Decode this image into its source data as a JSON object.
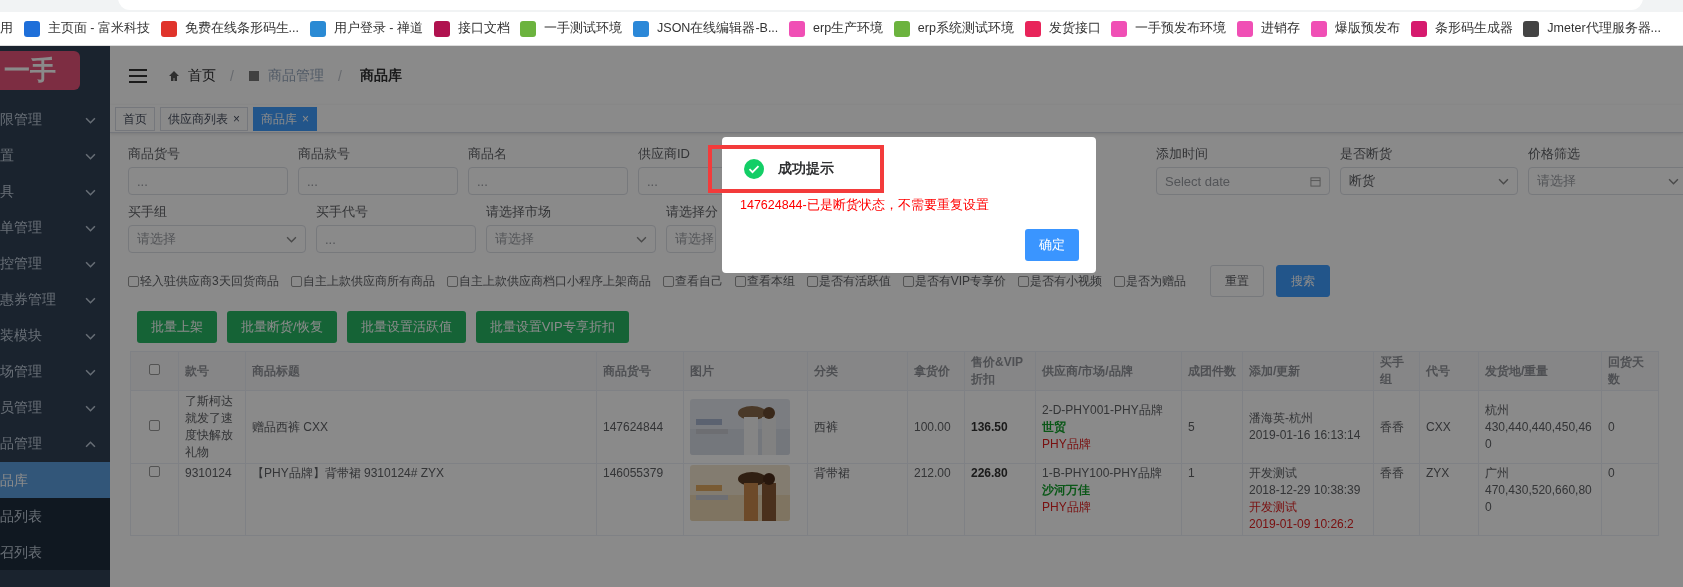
{
  "browser": {
    "bookmarks": [
      {
        "label": "用"
      },
      {
        "label": "主页面 - 富米科技",
        "color": "#1e6fd9"
      },
      {
        "label": "免费在线条形码生...",
        "color": "#e0342b"
      },
      {
        "label": "用户登录 - 禅道",
        "color": "#2a8ad4"
      },
      {
        "label": "接口文档",
        "color": "#b0124f"
      },
      {
        "label": "一手测试环境",
        "color": "#6cb33e"
      },
      {
        "label": "JSON在线编辑器-B...",
        "color": "#2b88d8"
      },
      {
        "label": "erp生产环境",
        "color": "#f04fb5"
      },
      {
        "label": "erp系统测试环境",
        "color": "#6cb33e"
      },
      {
        "label": "发货接口",
        "color": "#e8245a"
      },
      {
        "label": "一手预发布环境",
        "color": "#f04fb5"
      },
      {
        "label": "进销存",
        "color": "#f04fb5"
      },
      {
        "label": "爆版预发布",
        "color": "#f04fb5"
      },
      {
        "label": "条形码生成器",
        "color": "#d61a6e"
      },
      {
        "label": "Jmeter代理服务器...",
        "color": "#444444"
      }
    ]
  },
  "logo": "一手",
  "sidebar": [
    {
      "label": "限管理",
      "expanded": false
    },
    {
      "label": "置",
      "expanded": false
    },
    {
      "label": "具",
      "expanded": false
    },
    {
      "label": "单管理",
      "expanded": false
    },
    {
      "label": "控管理",
      "expanded": false
    },
    {
      "label": "惠券管理",
      "expanded": false
    },
    {
      "label": "装模块",
      "expanded": false
    },
    {
      "label": "场管理",
      "expanded": false
    },
    {
      "label": "员管理",
      "expanded": false
    },
    {
      "label": "品管理",
      "expanded": true,
      "children": [
        {
          "label": "品库",
          "selected": true
        },
        {
          "label": "品列表",
          "selected": false
        },
        {
          "label": "召列表",
          "selected": false
        }
      ]
    }
  ],
  "breadcrumb": [
    "首页",
    "商品管理",
    "商品库"
  ],
  "breadcrumb_separator": "/",
  "tabs": [
    {
      "label": "首页",
      "selected": false
    },
    {
      "label": "供应商列表",
      "close": "×",
      "selected": false
    },
    {
      "label": "商品库",
      "close": "×",
      "selected": true
    }
  ],
  "filters": [
    [
      {
        "label": "商品货号",
        "kind": "input",
        "placeholder": "..."
      },
      {
        "label": "商品款号",
        "kind": "input",
        "placeholder": "..."
      },
      {
        "label": "商品名",
        "kind": "input",
        "placeholder": "..."
      },
      {
        "label": "供应商ID",
        "kind": "input",
        "placeholder": "..."
      },
      {
        "label": "添加时间",
        "kind": "date",
        "placeholder": "Select date"
      },
      {
        "label": "是否断货",
        "kind": "select",
        "value": "断货"
      },
      {
        "label": "价格筛选",
        "kind": "select",
        "placeholder": "请选择"
      }
    ],
    [
      {
        "label": "买手组",
        "kind": "select",
        "placeholder": "请选择"
      },
      {
        "label": "买手代号",
        "kind": "input",
        "placeholder": "..."
      },
      {
        "label": "请选择市场",
        "kind": "select",
        "placeholder": "请选择"
      },
      {
        "label": "请选择分",
        "kind": "input",
        "placeholder": "请选择"
      }
    ]
  ],
  "options": [
    {
      "label": "轻入驻供应商3天回货商品",
      "checked": false
    },
    {
      "label": "自主上款供应商所有商品",
      "checked": false
    },
    {
      "label": "自主上款供应商档口小程序上架商品",
      "checked": false
    },
    {
      "label": "查看自己",
      "checked": false
    },
    {
      "label": "查看本组",
      "checked": false
    },
    {
      "label": "是否有活跃值",
      "checked": false
    },
    {
      "label": "是否有VIP专享价",
      "checked": false
    },
    {
      "label": "是否有小视频",
      "checked": false
    },
    {
      "label": "是否为赠品",
      "checked": false
    }
  ],
  "form_buttons": [
    {
      "label": "重置",
      "kind": "default"
    },
    {
      "label": "搜索",
      "kind": "primary"
    }
  ],
  "bulk_buttons": [
    "批量上架",
    "批量断货/恢复",
    "批量设置活跃值",
    "批量设置VIP专享折扣"
  ],
  "table": {
    "select_all": {
      "checked": false
    },
    "columns": [
      "款号",
      "商品标题",
      "商品货号",
      "图片",
      "分类",
      "拿货价",
      "售价&VIP折扣",
      "供应商/市场/品牌",
      "成团件数",
      "添加/更新",
      "买手组",
      "代号",
      "发货地/重量",
      "回货天数"
    ],
    "rows": [
      {
        "checked": false,
        "style_no": "了斯柯达就发了速度快解放礼物",
        "title": "赠品西裤 CXX",
        "sku": "147624844",
        "picture": {
          "kind": "picture"
        },
        "category": "西裤",
        "cost": "100.00",
        "price": "136.50",
        "supplier": {
          "code": "2-D-PHY001-PHY品牌",
          "market": "世贸",
          "brand": "PHY品牌"
        },
        "min_group": "5",
        "updates": [
          {
            "text": "潘海英-杭州",
            "kind": "normal"
          },
          {
            "text": "2019-01-16 16:13:14",
            "kind": "normal"
          }
        ],
        "buyer_group": "香香",
        "buyer_code": "CXX",
        "ship": {
          "place": "杭州",
          "weights": "430,440,440,450,460"
        },
        "return_days": "0"
      },
      {
        "checked": false,
        "style_no": "9310124",
        "title": "【PHY品牌】背带裙 9310124# ZYX",
        "sku": "146055379",
        "picture": {
          "kind": "picture"
        },
        "category": "背带裙",
        "cost": "212.00",
        "price": "226.80",
        "supplier": {
          "code": "1-B-PHY100-PHY品牌",
          "market": "沙河万佳",
          "brand": "PHY品牌"
        },
        "min_group": "1",
        "updates": [
          {
            "text": "开发测试",
            "kind": "normal"
          },
          {
            "text": "2018-12-29 10:38:39",
            "kind": "normal"
          },
          {
            "text": "开发测试",
            "kind": "alert"
          },
          {
            "text": "2019-01-09 10:26:2",
            "kind": "alert"
          }
        ],
        "buyer_group": "香香",
        "buyer_code": "ZYX",
        "ship": {
          "place": "广州",
          "weights": "470,430,520,660,800"
        },
        "return_days": "0"
      }
    ]
  },
  "dialog": {
    "title": "成功提示",
    "message": "147624844-已是断货状态，不需要重复设置",
    "button": "确定"
  }
}
